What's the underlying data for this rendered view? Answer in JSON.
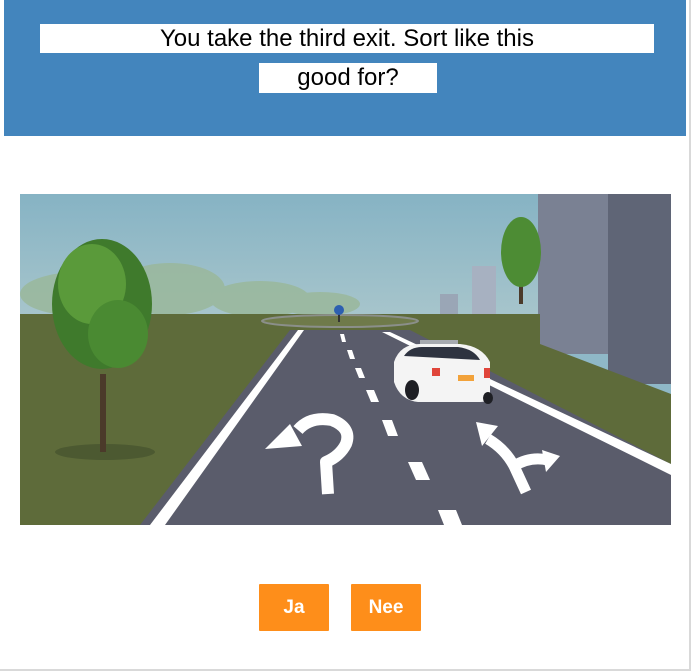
{
  "question": {
    "line1": "You take the third exit. Sort like this",
    "line2": "good for?"
  },
  "answers": {
    "yes_label": "Ja",
    "no_label": "Nee"
  },
  "scene": {
    "description_icon": "roundabout-road-scene",
    "colors": {
      "header": "#4385bd",
      "button": "#fe8e1a",
      "sky": "#8fb8c7",
      "asphalt": "#5a5c6b",
      "grass": "#5e6b3a"
    }
  }
}
